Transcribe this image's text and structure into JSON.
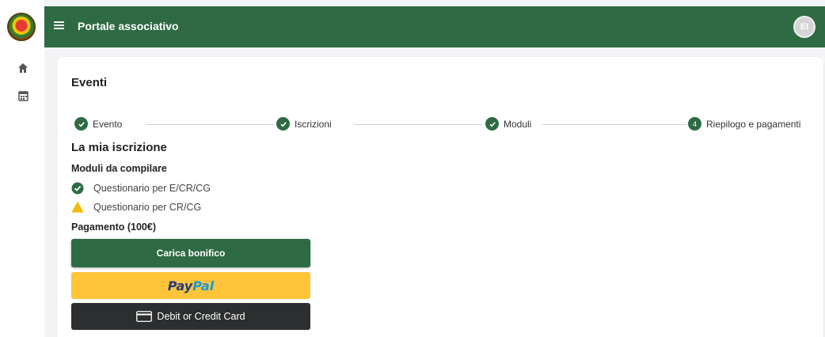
{
  "app": {
    "title": "Portale associativo",
    "avatar_initials": "EI",
    "brand_color": "#2e6b44"
  },
  "sidebar": {
    "items": [
      {
        "icon": "home-icon"
      },
      {
        "icon": "calendar-icon"
      }
    ]
  },
  "page": {
    "title": "Eventi"
  },
  "stepper": {
    "steps": [
      {
        "label": "Evento",
        "state": "done"
      },
      {
        "label": "Iscrizioni",
        "state": "done"
      },
      {
        "label": "Moduli",
        "state": "done"
      },
      {
        "label": "Riepilogo e pagamenti",
        "state": "active",
        "number": "4"
      }
    ]
  },
  "summary": {
    "title": "La mia iscrizione",
    "modules_title": "Moduli da compilare",
    "modules": [
      {
        "label": "Questionario per E/CR/CG",
        "status": "complete"
      },
      {
        "label": "Questionario per CR/CG",
        "status": "warning"
      }
    ],
    "payment_title": "Pagamento (100€)"
  },
  "payment": {
    "upload_label": "Carica bonifico",
    "paypal_part1": "Pay",
    "paypal_part2": "Pal",
    "card_label": "Debit or Credit Card"
  }
}
